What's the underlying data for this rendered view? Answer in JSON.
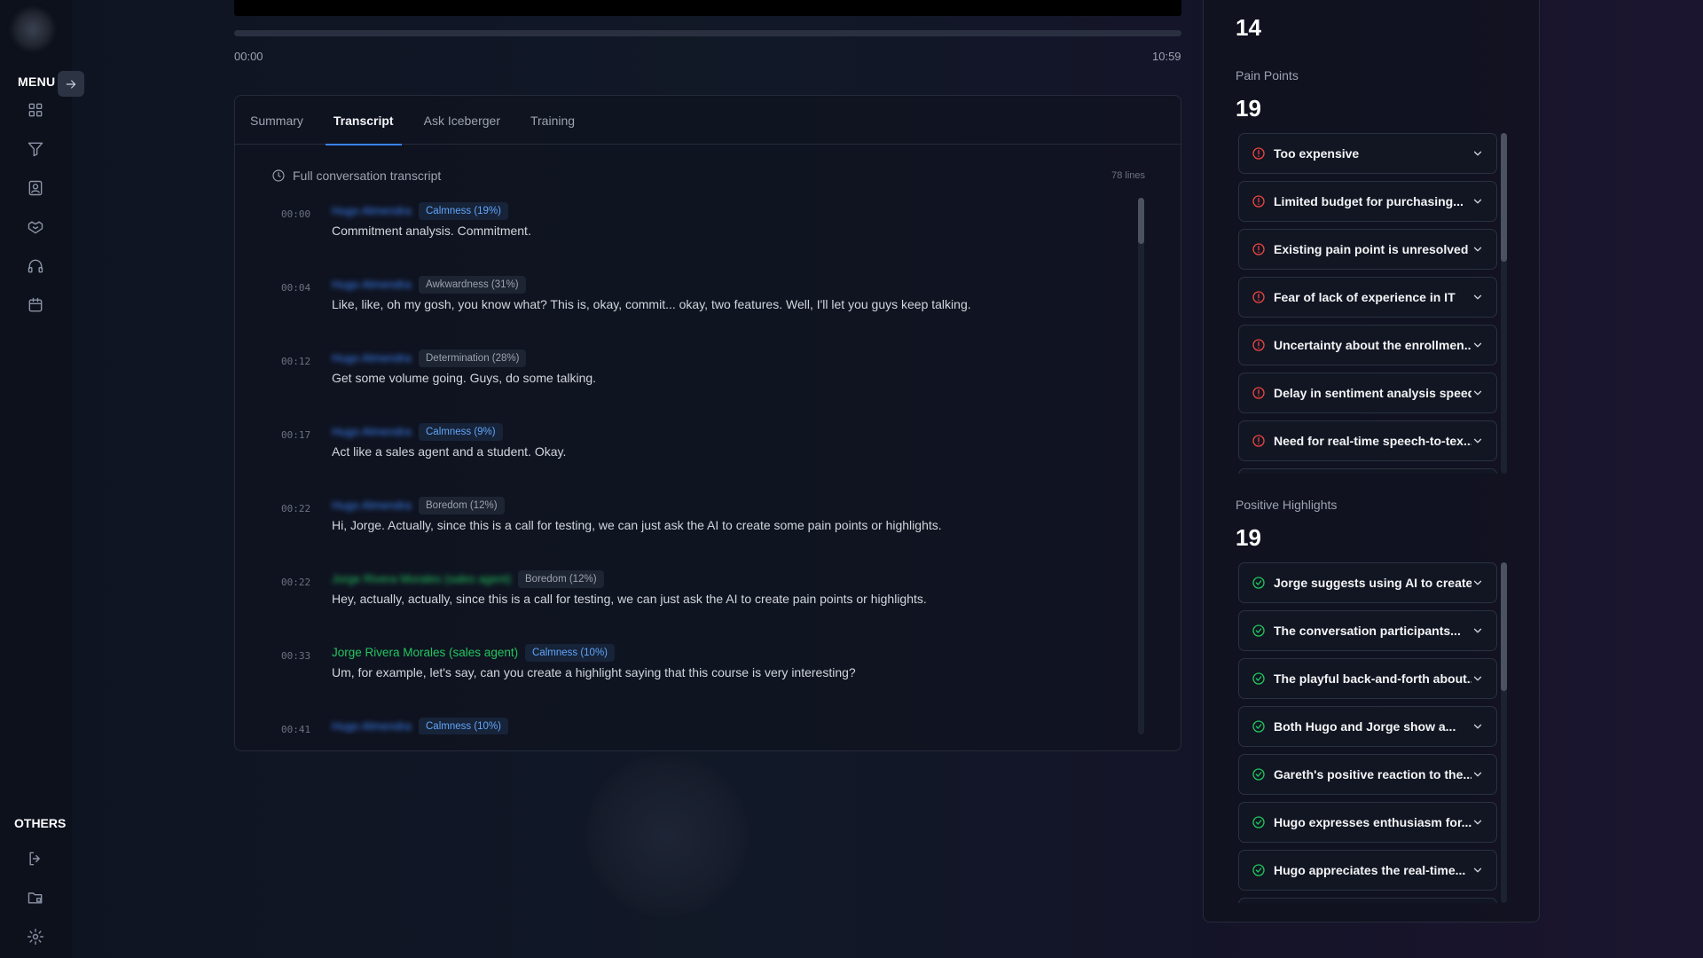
{
  "sidebar": {
    "menu_label": "MENU",
    "others_label": "OTHERS",
    "nav_icons": [
      "dashboard-grid-icon",
      "filter-icon",
      "contact-card-icon",
      "handshake-icon",
      "headset-icon",
      "calendar-icon"
    ],
    "other_icons": [
      "logout-icon",
      "folder-lock-icon",
      "settings-gear-icon"
    ]
  },
  "player": {
    "time_start": "00:00",
    "time_end": "10:59",
    "progress_fraction": 0.0
  },
  "tabs": [
    {
      "label": "Summary",
      "active": false
    },
    {
      "label": "Transcript",
      "active": true
    },
    {
      "label": "Ask Iceberger",
      "active": false
    },
    {
      "label": "Training",
      "active": false
    }
  ],
  "transcript": {
    "title": "Full conversation transcript",
    "line_count": "78 lines",
    "entries": [
      {
        "time": "00:00",
        "speaker": "Hugo Almendra",
        "emotion": "Calmness (19%)",
        "text": "Commitment analysis. Commitment."
      },
      {
        "time": "00:04",
        "speaker": "Hugo Almendra",
        "emotion": "Awkwardness (31%)",
        "text": "Like, like, oh my gosh, you know what? This is, okay, commit... okay, two features. Well, I'll let you guys keep talking."
      },
      {
        "time": "00:12",
        "speaker": "Hugo Almendra",
        "emotion": "Determination (28%)",
        "text": "Get some volume going. Guys, do some talking."
      },
      {
        "time": "00:17",
        "speaker": "Hugo Almendra",
        "emotion": "Calmness (9%)",
        "text": "Act like a sales agent and a student. Okay."
      },
      {
        "time": "00:22",
        "speaker": "Hugo Almendra",
        "emotion": "Boredom (12%)",
        "text": "Hi, Jorge. Actually, since this is a call for testing, we can just ask the AI to create some pain points or highlights."
      },
      {
        "time": "00:22",
        "speaker": "Jorge Rivera Morales (sales agent)",
        "emotion": "Boredom (12%)",
        "text": "Hey, actually, actually, since this is a call for testing, we can just ask the AI to create pain points or highlights."
      },
      {
        "time": "00:33",
        "speaker": "Jorge Rivera Morales (sales agent)",
        "emotion": "Calmness (10%)",
        "text": "Um, for example, let's say, can you create a highlight saying that this course is very interesting?"
      },
      {
        "time": "00:41",
        "speaker": "Hugo Almendra",
        "emotion": "Calmness (10%)",
        "text": ""
      }
    ]
  },
  "right": {
    "top_number": "14",
    "pain_points": {
      "label": "Pain Points",
      "count": "19",
      "items": [
        "Too expensive",
        "Limited budget for purchasing...",
        "Existing pain point is unresolved",
        "Fear of lack of experience in IT",
        "Uncertainty about the enrollmen...",
        "Delay in sentiment analysis speed",
        "Need for real-time speech-to-tex..."
      ]
    },
    "positive_highlights": {
      "label": "Positive Highlights",
      "count": "19",
      "items": [
        "Jorge suggests using AI to create...",
        "The conversation participants...",
        "The playful back-and-forth about...",
        "Both Hugo and Jorge show a...",
        "Gareth's positive reaction to the...",
        "Hugo expresses enthusiasm for...",
        "Hugo appreciates the real-time..."
      ]
    }
  },
  "colors": {
    "accent": "#3b82f6",
    "pain": "#ef4444",
    "positive": "#22c55e"
  }
}
